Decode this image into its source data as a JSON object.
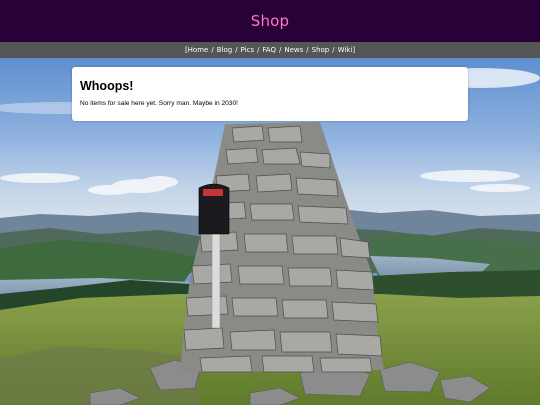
{
  "header": {
    "title": "Shop"
  },
  "nav": {
    "open_bracket": "[",
    "close_bracket": "]",
    "separator": "/",
    "items": [
      {
        "label": "Home"
      },
      {
        "label": "Blog"
      },
      {
        "label": "Pics"
      },
      {
        "label": "FAQ"
      },
      {
        "label": "News"
      },
      {
        "label": "Shop"
      },
      {
        "label": "Wiki"
      }
    ]
  },
  "card": {
    "title": "Whoops!",
    "message": "No items for sale here yet. Sorry man. Maybe in 2030!"
  },
  "colors": {
    "header_bg": "#2a0038",
    "title_color": "#ff78c8",
    "nav_bg": "#555555"
  }
}
